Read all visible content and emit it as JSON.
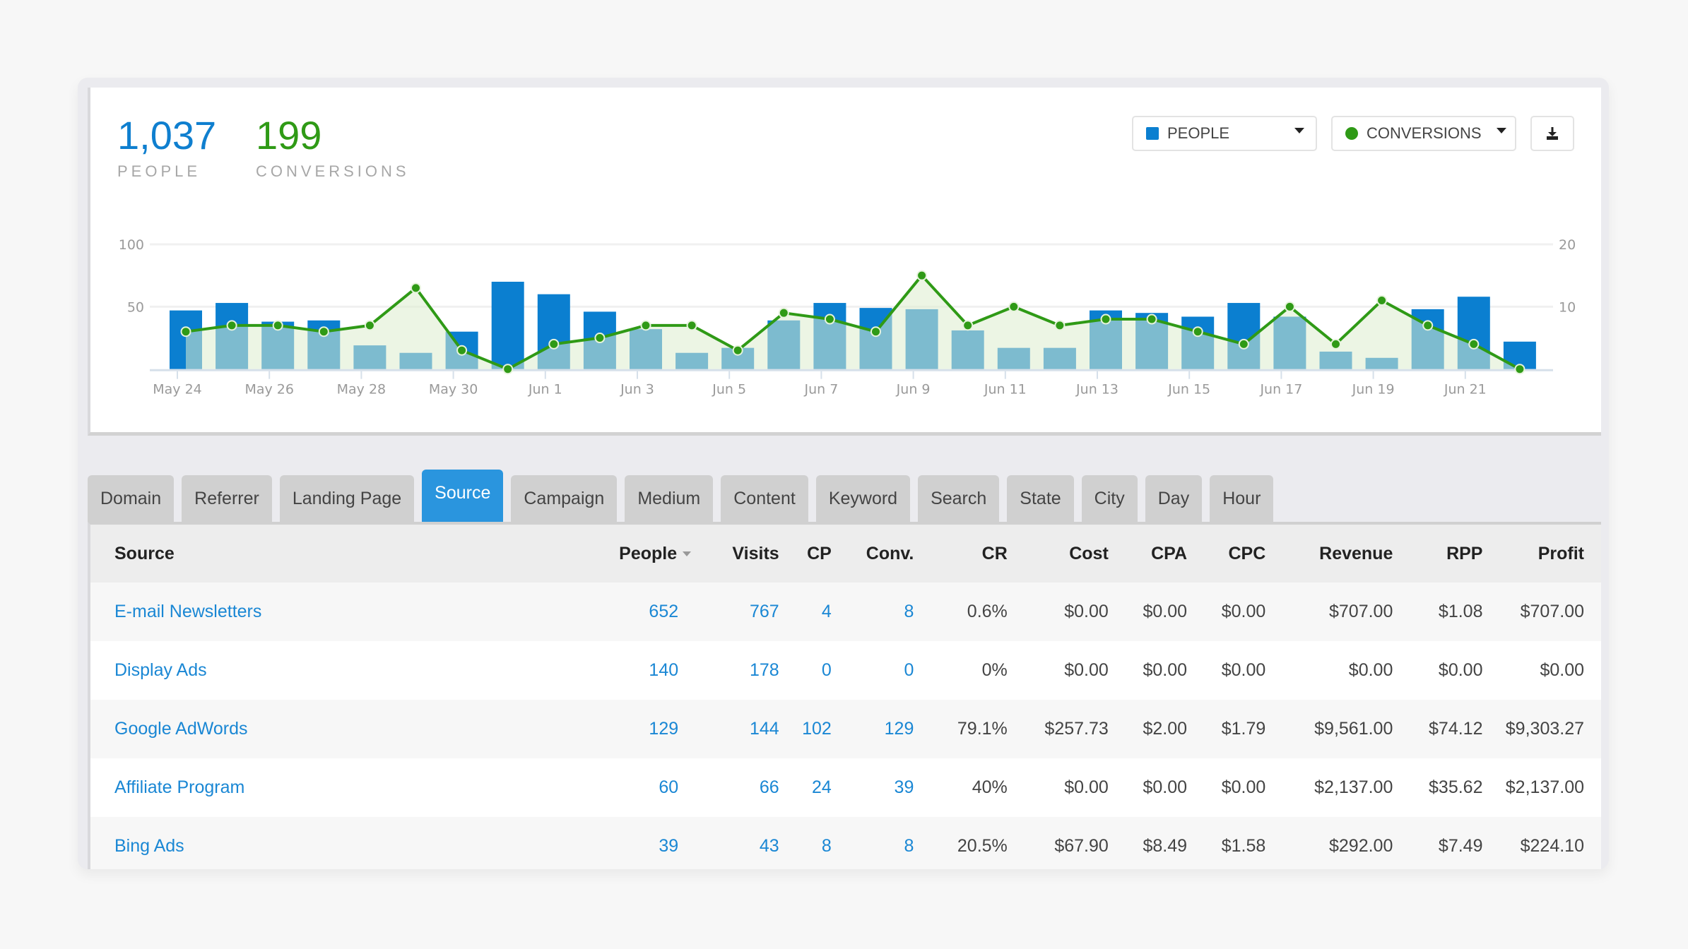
{
  "summary": {
    "people": {
      "value": "1,037",
      "label": "PEOPLE"
    },
    "conversions": {
      "value": "199",
      "label": "CONVERSIONS"
    }
  },
  "controls": {
    "people_dropdown": {
      "label": "PEOPLE",
      "icon": "square-swatch-icon"
    },
    "conversions_dropdown": {
      "label": "CONVERSIONS",
      "icon": "circle-swatch-icon"
    },
    "download_button": {
      "icon": "download-icon"
    }
  },
  "colors": {
    "people": "#0b7fd0",
    "people_bar": "#0a86c0",
    "conversions": "#2f9a16",
    "conversions_fill": "#eaf4e2",
    "active_tab": "#2a95de",
    "link": "#1a87d4"
  },
  "chart_data": {
    "type": "bar",
    "title": "",
    "xlabel": "",
    "ylabel": "",
    "categories": [
      "May 24",
      "May 25",
      "May 26",
      "May 27",
      "May 28",
      "May 29",
      "May 30",
      "May 31",
      "Jun 1",
      "Jun 2",
      "Jun 3",
      "Jun 4",
      "Jun 5",
      "Jun 6",
      "Jun 7",
      "Jun 8",
      "Jun 9",
      "Jun 10",
      "Jun 11",
      "Jun 12",
      "Jun 13",
      "Jun 14",
      "Jun 15",
      "Jun 16",
      "Jun 17",
      "Jun 18",
      "Jun 19",
      "Jun 20",
      "Jun 21",
      "Jun 22"
    ],
    "x_tick_labels": [
      "May 24",
      "May 26",
      "May 28",
      "May 30",
      "Jun 1",
      "Jun 3",
      "Jun 5",
      "Jun 7",
      "Jun 9",
      "Jun 11",
      "Jun 13",
      "Jun 15",
      "Jun 17",
      "Jun 19",
      "Jun 21"
    ],
    "series": [
      {
        "name": "People",
        "type": "bar",
        "axis": "left",
        "values": [
          47,
          53,
          38,
          39,
          19,
          13,
          30,
          70,
          60,
          46,
          32,
          13,
          17,
          39,
          53,
          49,
          48,
          31,
          17,
          17,
          47,
          45,
          42,
          53,
          42,
          14,
          9,
          48,
          58,
          22
        ]
      },
      {
        "name": "Conversions",
        "type": "area-line",
        "axis": "right",
        "values": [
          6,
          7,
          7,
          6,
          7,
          13,
          3,
          0,
          4,
          5,
          7,
          7,
          3,
          9,
          8,
          6,
          15,
          7,
          10,
          7,
          8,
          8,
          6,
          4,
          10,
          4,
          11,
          7,
          4,
          0
        ]
      }
    ],
    "y_left": {
      "ticks": [
        50,
        100
      ],
      "ylim": [
        0,
        100
      ]
    },
    "y_right": {
      "ticks": [
        10,
        20
      ],
      "ylim": [
        0,
        20
      ]
    },
    "grid": true,
    "legend": "none"
  },
  "tabs": [
    {
      "label": "Domain",
      "active": false
    },
    {
      "label": "Referrer",
      "active": false
    },
    {
      "label": "Landing Page",
      "active": false
    },
    {
      "label": "Source",
      "active": true
    },
    {
      "label": "Campaign",
      "active": false
    },
    {
      "label": "Medium",
      "active": false
    },
    {
      "label": "Content",
      "active": false
    },
    {
      "label": "Keyword",
      "active": false
    },
    {
      "label": "Search",
      "active": false
    },
    {
      "label": "State",
      "active": false
    },
    {
      "label": "City",
      "active": false
    },
    {
      "label": "Day",
      "active": false
    },
    {
      "label": "Hour",
      "active": false
    }
  ],
  "table": {
    "columns": [
      "Source",
      "People",
      "Visits",
      "CP",
      "Conv.",
      "CR",
      "Cost",
      "CPA",
      "CPC",
      "Revenue",
      "RPP",
      "Profit"
    ],
    "sorted_column": "People",
    "rows": [
      [
        "E-mail Newsletters",
        "652",
        "767",
        "4",
        "8",
        "0.6%",
        "$0.00",
        "$0.00",
        "$0.00",
        "$707.00",
        "$1.08",
        "$707.00"
      ],
      [
        "Display Ads",
        "140",
        "178",
        "0",
        "0",
        "0%",
        "$0.00",
        "$0.00",
        "$0.00",
        "$0.00",
        "$0.00",
        "$0.00"
      ],
      [
        "Google AdWords",
        "129",
        "144",
        "102",
        "129",
        "79.1%",
        "$257.73",
        "$2.00",
        "$1.79",
        "$9,561.00",
        "$74.12",
        "$9,303.27"
      ],
      [
        "Affiliate Program",
        "60",
        "66",
        "24",
        "39",
        "40%",
        "$0.00",
        "$0.00",
        "$0.00",
        "$2,137.00",
        "$35.62",
        "$2,137.00"
      ],
      [
        "Bing Ads",
        "39",
        "43",
        "8",
        "8",
        "20.5%",
        "$67.90",
        "$8.49",
        "$1.58",
        "$292.00",
        "$7.49",
        "$224.10"
      ]
    ]
  }
}
